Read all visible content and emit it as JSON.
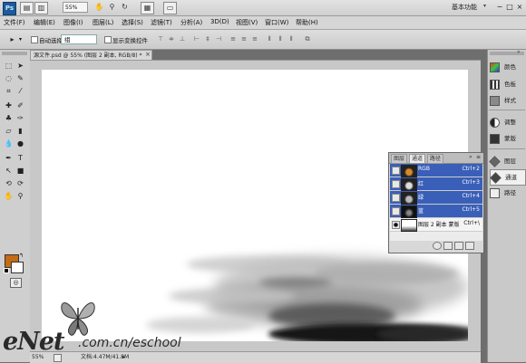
{
  "appbar": {
    "logo": "Ps",
    "zoom": "55%",
    "workspace": "基本功能",
    "workspace_arrow": "▾",
    "icons": [
      "br-icon",
      "mini-bridge-icon",
      "hand-icon",
      "zoom-icon",
      "rotate-icon",
      "arrange-icon",
      "screen-mode-icon"
    ],
    "window_controls": [
      "−",
      "□",
      "×"
    ]
  },
  "menu": [
    "文件(F)",
    "编辑(E)",
    "图像(I)",
    "图层(L)",
    "选择(S)",
    "滤镜(T)",
    "分析(A)",
    "3D(D)",
    "视图(V)",
    "窗口(W)",
    "帮助(H)"
  ],
  "options": {
    "auto_select_label": "自动选择:",
    "auto_select_value": "组",
    "show_transform_label": "显示变换控件"
  },
  "document": {
    "tab_title": "源文件.psd @ 55% (图层 2 副本, RGB/8) *",
    "zoom": "55%",
    "doc_size": "文档:4.47M/41.8M"
  },
  "dock": [
    {
      "label": "颜色",
      "icon": "color-icon"
    },
    {
      "label": "色板",
      "icon": "swatches-icon"
    },
    {
      "label": "样式",
      "icon": "styles-icon"
    },
    {
      "label": "调整",
      "icon": "adjustments-icon"
    },
    {
      "label": "蒙版",
      "icon": "masks-icon"
    },
    {
      "label": "图层",
      "icon": "layers-icon"
    },
    {
      "label": "通道",
      "icon": "channels-icon"
    },
    {
      "label": "路径",
      "icon": "paths-icon"
    }
  ],
  "channels_panel": {
    "tabs": [
      "图层",
      "通道",
      "路径"
    ],
    "rows": [
      {
        "name": "RGB",
        "shortcut": "Ctrl+2",
        "selected": true
      },
      {
        "name": "红",
        "shortcut": "Ctrl+3",
        "selected": true
      },
      {
        "name": "绿",
        "shortcut": "Ctrl+4",
        "selected": true
      },
      {
        "name": "蓝",
        "shortcut": "Ctrl+5",
        "selected": true
      },
      {
        "name": "图层 2 副本 蒙版",
        "shortcut": "Ctrl+\\",
        "selected": false
      }
    ]
  },
  "watermark": {
    "brand": "eNet",
    "domain": ".com.cn/eschool"
  },
  "colors": {
    "foreground": "#c56b13",
    "background": "#ffffff",
    "selection": "#3a5fb8"
  }
}
